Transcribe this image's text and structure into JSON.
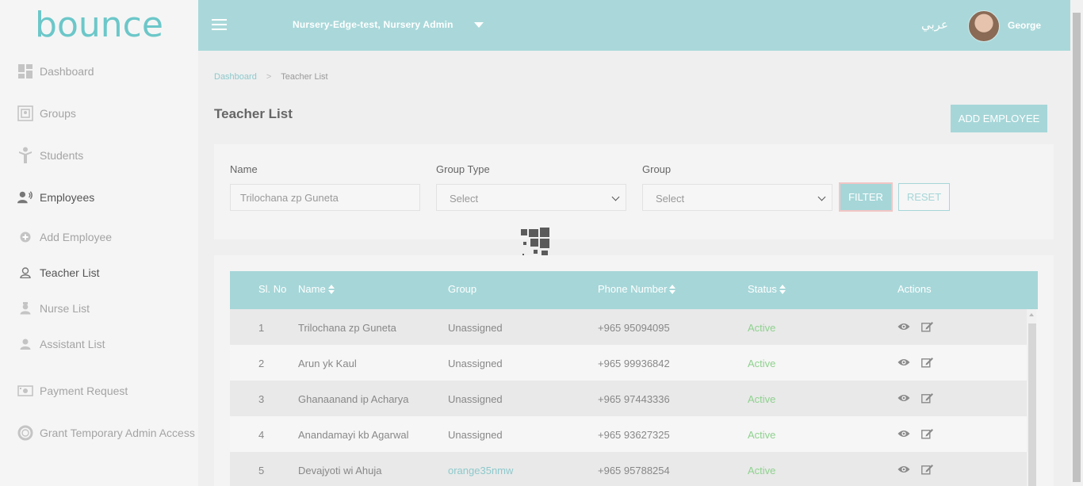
{
  "app": {
    "logo_text": "bounce",
    "brand_color": "#6cc7c9",
    "accent_color": "#a6d6d8"
  },
  "header": {
    "nursery_label": "Nursery-Edge-test, Nursery Admin",
    "language_toggle": "عربي",
    "user_name": "George"
  },
  "sidebar": {
    "items": [
      {
        "label": "Dashboard",
        "icon": "dashboard-icon"
      },
      {
        "label": "Groups",
        "icon": "groups-icon"
      },
      {
        "label": "Students",
        "icon": "student-icon"
      },
      {
        "label": "Employees",
        "icon": "employees-icon"
      },
      {
        "label": "Add Employee",
        "icon": "plus-circle-icon"
      },
      {
        "label": "Teacher List",
        "icon": "user-outline-icon"
      },
      {
        "label": "Nurse List",
        "icon": "nurse-icon"
      },
      {
        "label": "Assistant List",
        "icon": "user-icon"
      },
      {
        "label": "Payment Request",
        "icon": "payment-icon"
      },
      {
        "label": "Grant Temporary Admin Access",
        "icon": "lifebuoy-icon"
      }
    ]
  },
  "breadcrumb": {
    "home": "Dashboard",
    "current": "Teacher List"
  },
  "page": {
    "title": "Teacher List",
    "add_button": "ADD EMPLOYEE"
  },
  "filters": {
    "name_label": "Name",
    "name_value": "Trilochana zp Guneta",
    "group_type_label": "Group Type",
    "group_type_value": "Select",
    "group_label": "Group",
    "group_value": "Select",
    "filter_button": "FILTER",
    "reset_button": "RESET"
  },
  "table": {
    "headers": [
      "Sl. No",
      "Name",
      "Group",
      "Phone Number",
      "Status",
      "Actions"
    ],
    "rows": [
      {
        "no": "1",
        "name": "Trilochana zp Guneta",
        "group": "Unassigned",
        "phone": "+965 95094095",
        "status": "Active"
      },
      {
        "no": "2",
        "name": "Arun yk Kaul",
        "group": "Unassigned",
        "phone": "+965 99936842",
        "status": "Active"
      },
      {
        "no": "3",
        "name": "Ghanaanand ip Acharya",
        "group": "Unassigned",
        "phone": "+965 97443336",
        "status": "Active"
      },
      {
        "no": "4",
        "name": "Anandamayi kb Agarwal",
        "group": "Unassigned",
        "phone": "+965 93627325",
        "status": "Active"
      },
      {
        "no": "5",
        "name": "Devajyoti wi Ahuja",
        "group": "orange35nmw",
        "phone": "+965 95788254",
        "status": "Active"
      }
    ]
  }
}
